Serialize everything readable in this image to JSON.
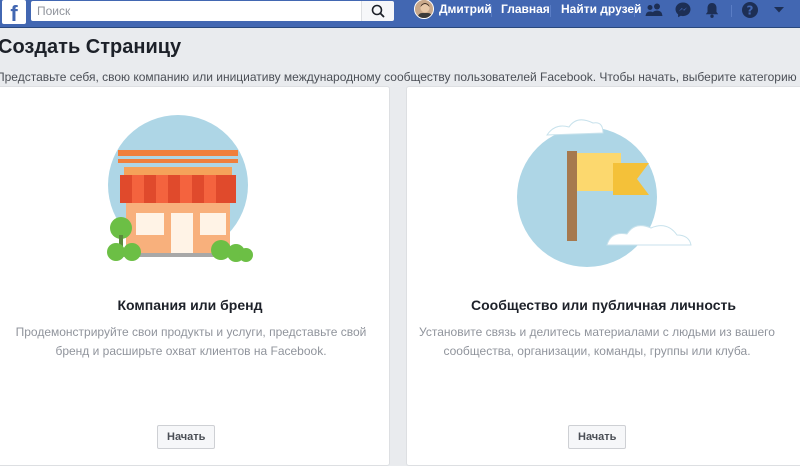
{
  "header": {
    "logo": "f",
    "search_placeholder": "Поиск",
    "user_name": "Дмитрий",
    "nav_home": "Главная",
    "nav_find_friends": "Найти друзей",
    "icons": [
      "friend-requests-icon",
      "messenger-icon",
      "notifications-icon",
      "help-icon",
      "account-menu-chevron-icon"
    ]
  },
  "page": {
    "title": "Создать Страницу",
    "subtitle": "Представьте себя, свою компанию или инициативу международному сообществу пользователей Facebook. Чтобы начать, выберите категорию"
  },
  "cards": [
    {
      "title": "Компания или бренд",
      "description_line1": "Продемонстрируйте свои продукты и услуги, представьте свой",
      "description_line2": "бренд и расширьте охват клиентов на Facebook.",
      "button": "Начать"
    },
    {
      "title": "Сообщество или публичная личность",
      "description_line1": "Установите связь и делитесь материалами с людьми из вашего",
      "description_line2": "сообщества, организации, команды, группы или клуба.",
      "button": "Начать"
    }
  ],
  "colors": {
    "brand": "#4267b2",
    "background": "#e9ebee",
    "illustration_circle": "#aed6e6",
    "store_awning_red": "#e04a2c",
    "store_wall": "#f8b07c",
    "tree_green": "#6cbf45",
    "flag_yellow": "#fcd86e",
    "flag_pole": "#a6794e"
  }
}
